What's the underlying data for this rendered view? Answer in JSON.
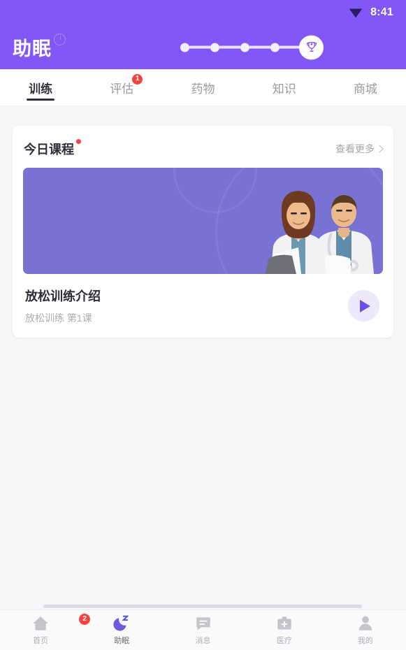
{
  "status_bar": {
    "time": "8:41",
    "wifi_icon": "wifi-signal-icon"
  },
  "header": {
    "title": "助眠",
    "info_icon": "info-circle-icon",
    "stepper": {
      "dots": 4,
      "goal_icon": "trophy-icon"
    },
    "background_color": "#8257F5"
  },
  "tabs": [
    {
      "label": "训练",
      "active": true,
      "badge": ""
    },
    {
      "label": "评估",
      "active": false,
      "badge": "1"
    },
    {
      "label": "药物",
      "active": false,
      "badge": ""
    },
    {
      "label": "知识",
      "active": false,
      "badge": ""
    },
    {
      "label": "商城",
      "active": false,
      "badge": ""
    }
  ],
  "card": {
    "title": "今日课程",
    "title_dot_color": "#F5443B",
    "more_label": "查看更多",
    "more_icon": "chevron-right-icon",
    "banner": {
      "image_alt": "two-doctors-illustration",
      "background_color": "#7873D2"
    },
    "course": {
      "name": "放松训练介绍",
      "subtitle": "放松训练 第1课",
      "play_icon": "play-icon"
    }
  },
  "bottom_nav": [
    {
      "label": "首页",
      "icon": "home-icon",
      "active": false,
      "badge": ""
    },
    {
      "label": "助眠",
      "icon": "moon-icon",
      "active": true,
      "badge": "2"
    },
    {
      "label": "消息",
      "icon": "message-icon",
      "active": false,
      "badge": ""
    },
    {
      "label": "医疗",
      "icon": "medical-icon",
      "active": false,
      "badge": ""
    },
    {
      "label": "我的",
      "icon": "profile-icon",
      "active": false,
      "badge": ""
    }
  ]
}
